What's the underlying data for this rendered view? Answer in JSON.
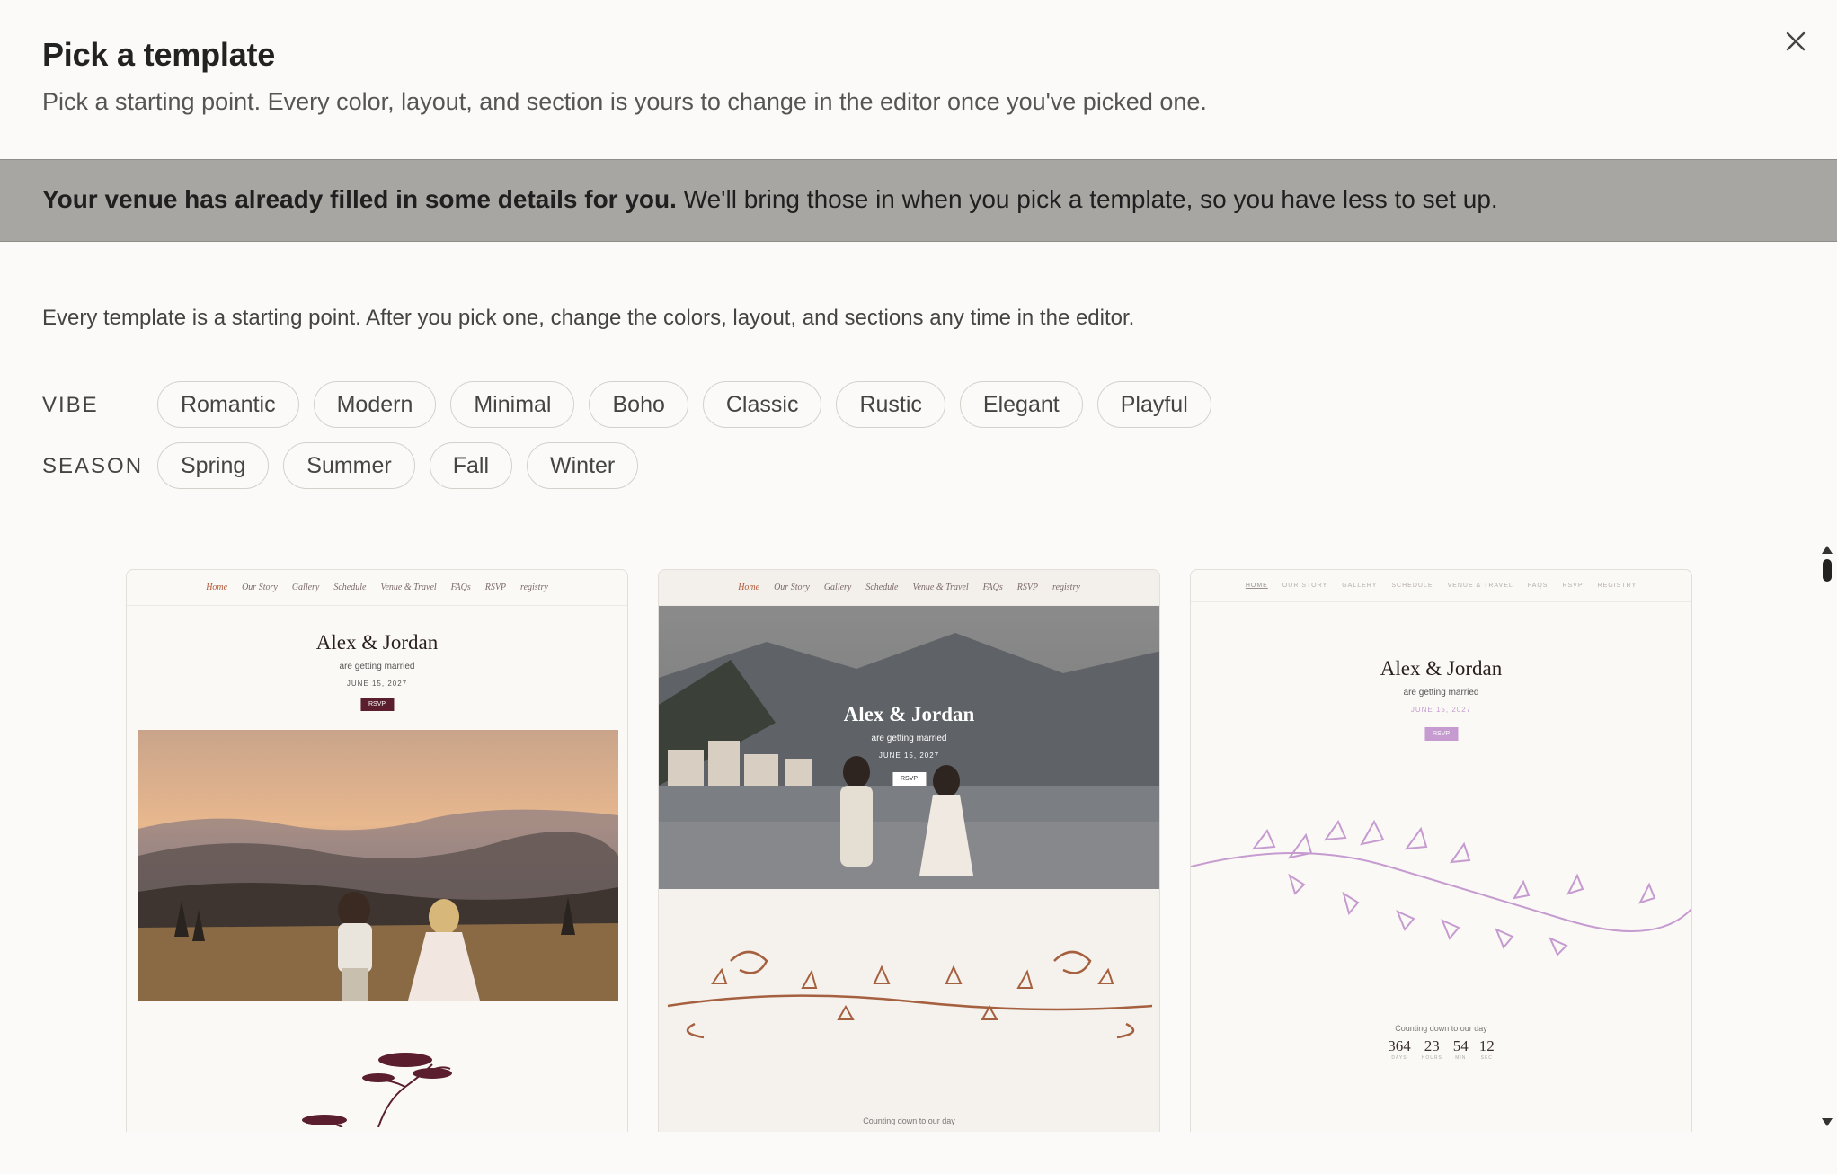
{
  "modal": {
    "title": "Pick a template",
    "subtitle": "Pick a starting point. Every color, layout, and section is yours to change in the editor once you've picked one.",
    "close_icon": "close-icon"
  },
  "notice": {
    "bold": "Your venue has already filled in some details for you.",
    "text": " We'll bring those in when you pick a template, so you have less to set up."
  },
  "hint": "Every template is a starting point. After you pick one, change the colors, layout, and sections any time in the editor.",
  "filters": {
    "vibe_label": "VIBE",
    "vibe": [
      "Romantic",
      "Modern",
      "Minimal",
      "Boho",
      "Classic",
      "Rustic",
      "Elegant",
      "Playful"
    ],
    "season_label": "SEASON",
    "season": [
      "Spring",
      "Summer",
      "Fall",
      "Winter"
    ]
  },
  "templates": [
    {
      "nav": [
        "Home",
        "Our Story",
        "Gallery",
        "Schedule",
        "Venue & Travel",
        "FAQs",
        "RSVP",
        "registry"
      ],
      "couple": "Alex & Jordan",
      "sub": "are getting married",
      "date": "JUNE 15, 2027",
      "rsvp": "RSVP",
      "accent": "#5a1e2e"
    },
    {
      "nav": [
        "Home",
        "Our Story",
        "Gallery",
        "Schedule",
        "Venue & Travel",
        "FAQs",
        "RSVP",
        "registry"
      ],
      "couple": "Alex & Jordan",
      "sub": "are getting married",
      "date": "JUNE 15, 2027",
      "rsvp": "RSVP",
      "countdown_label": "Counting down to our day",
      "accent": "#a5603f"
    },
    {
      "nav": [
        "HOME",
        "OUR STORY",
        "GALLERY",
        "SCHEDULE",
        "VENUE & TRAVEL",
        "FAQS",
        "RSVP",
        "REGISTRY"
      ],
      "couple": "Alex & Jordan",
      "sub": "are getting married",
      "date": "JUNE 15, 2027",
      "rsvp": "RSVP",
      "countdown_label": "Counting down to our day",
      "countdown": [
        {
          "num": "364",
          "unit": "DAYS"
        },
        {
          "num": "23",
          "unit": "HOURS"
        },
        {
          "num": "54",
          "unit": "MIN"
        },
        {
          "num": "12",
          "unit": "SEC"
        }
      ],
      "accent": "#c59bd0"
    }
  ]
}
